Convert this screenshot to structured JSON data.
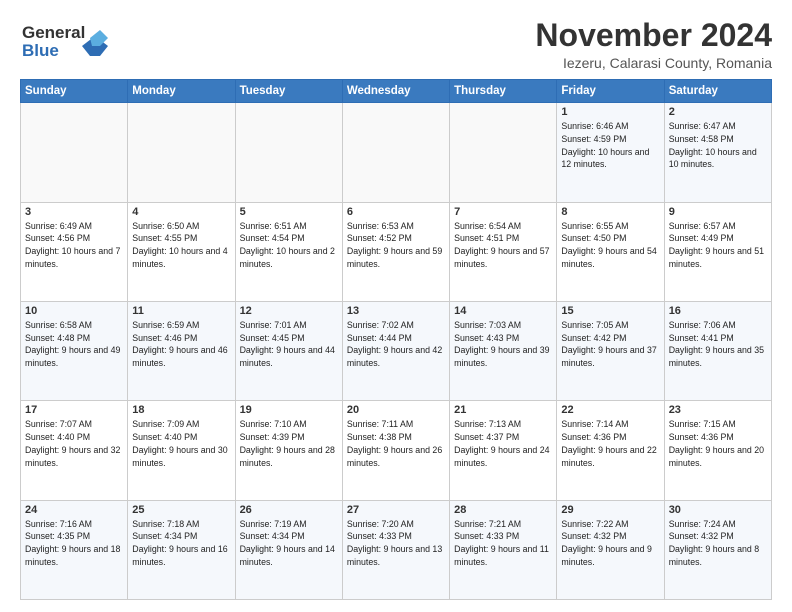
{
  "header": {
    "logo_line1": "General",
    "logo_line2": "Blue",
    "month": "November 2024",
    "location": "Iezeru, Calarasi County, Romania"
  },
  "weekdays": [
    "Sunday",
    "Monday",
    "Tuesday",
    "Wednesday",
    "Thursday",
    "Friday",
    "Saturday"
  ],
  "weeks": [
    [
      {
        "day": "",
        "sunrise": "",
        "sunset": "",
        "daylight": ""
      },
      {
        "day": "",
        "sunrise": "",
        "sunset": "",
        "daylight": ""
      },
      {
        "day": "",
        "sunrise": "",
        "sunset": "",
        "daylight": ""
      },
      {
        "day": "",
        "sunrise": "",
        "sunset": "",
        "daylight": ""
      },
      {
        "day": "",
        "sunrise": "",
        "sunset": "",
        "daylight": ""
      },
      {
        "day": "1",
        "sunrise": "Sunrise: 6:46 AM",
        "sunset": "Sunset: 4:59 PM",
        "daylight": "Daylight: 10 hours and 12 minutes."
      },
      {
        "day": "2",
        "sunrise": "Sunrise: 6:47 AM",
        "sunset": "Sunset: 4:58 PM",
        "daylight": "Daylight: 10 hours and 10 minutes."
      }
    ],
    [
      {
        "day": "3",
        "sunrise": "Sunrise: 6:49 AM",
        "sunset": "Sunset: 4:56 PM",
        "daylight": "Daylight: 10 hours and 7 minutes."
      },
      {
        "day": "4",
        "sunrise": "Sunrise: 6:50 AM",
        "sunset": "Sunset: 4:55 PM",
        "daylight": "Daylight: 10 hours and 4 minutes."
      },
      {
        "day": "5",
        "sunrise": "Sunrise: 6:51 AM",
        "sunset": "Sunset: 4:54 PM",
        "daylight": "Daylight: 10 hours and 2 minutes."
      },
      {
        "day": "6",
        "sunrise": "Sunrise: 6:53 AM",
        "sunset": "Sunset: 4:52 PM",
        "daylight": "Daylight: 9 hours and 59 minutes."
      },
      {
        "day": "7",
        "sunrise": "Sunrise: 6:54 AM",
        "sunset": "Sunset: 4:51 PM",
        "daylight": "Daylight: 9 hours and 57 minutes."
      },
      {
        "day": "8",
        "sunrise": "Sunrise: 6:55 AM",
        "sunset": "Sunset: 4:50 PM",
        "daylight": "Daylight: 9 hours and 54 minutes."
      },
      {
        "day": "9",
        "sunrise": "Sunrise: 6:57 AM",
        "sunset": "Sunset: 4:49 PM",
        "daylight": "Daylight: 9 hours and 51 minutes."
      }
    ],
    [
      {
        "day": "10",
        "sunrise": "Sunrise: 6:58 AM",
        "sunset": "Sunset: 4:48 PM",
        "daylight": "Daylight: 9 hours and 49 minutes."
      },
      {
        "day": "11",
        "sunrise": "Sunrise: 6:59 AM",
        "sunset": "Sunset: 4:46 PM",
        "daylight": "Daylight: 9 hours and 46 minutes."
      },
      {
        "day": "12",
        "sunrise": "Sunrise: 7:01 AM",
        "sunset": "Sunset: 4:45 PM",
        "daylight": "Daylight: 9 hours and 44 minutes."
      },
      {
        "day": "13",
        "sunrise": "Sunrise: 7:02 AM",
        "sunset": "Sunset: 4:44 PM",
        "daylight": "Daylight: 9 hours and 42 minutes."
      },
      {
        "day": "14",
        "sunrise": "Sunrise: 7:03 AM",
        "sunset": "Sunset: 4:43 PM",
        "daylight": "Daylight: 9 hours and 39 minutes."
      },
      {
        "day": "15",
        "sunrise": "Sunrise: 7:05 AM",
        "sunset": "Sunset: 4:42 PM",
        "daylight": "Daylight: 9 hours and 37 minutes."
      },
      {
        "day": "16",
        "sunrise": "Sunrise: 7:06 AM",
        "sunset": "Sunset: 4:41 PM",
        "daylight": "Daylight: 9 hours and 35 minutes."
      }
    ],
    [
      {
        "day": "17",
        "sunrise": "Sunrise: 7:07 AM",
        "sunset": "Sunset: 4:40 PM",
        "daylight": "Daylight: 9 hours and 32 minutes."
      },
      {
        "day": "18",
        "sunrise": "Sunrise: 7:09 AM",
        "sunset": "Sunset: 4:40 PM",
        "daylight": "Daylight: 9 hours and 30 minutes."
      },
      {
        "day": "19",
        "sunrise": "Sunrise: 7:10 AM",
        "sunset": "Sunset: 4:39 PM",
        "daylight": "Daylight: 9 hours and 28 minutes."
      },
      {
        "day": "20",
        "sunrise": "Sunrise: 7:11 AM",
        "sunset": "Sunset: 4:38 PM",
        "daylight": "Daylight: 9 hours and 26 minutes."
      },
      {
        "day": "21",
        "sunrise": "Sunrise: 7:13 AM",
        "sunset": "Sunset: 4:37 PM",
        "daylight": "Daylight: 9 hours and 24 minutes."
      },
      {
        "day": "22",
        "sunrise": "Sunrise: 7:14 AM",
        "sunset": "Sunset: 4:36 PM",
        "daylight": "Daylight: 9 hours and 22 minutes."
      },
      {
        "day": "23",
        "sunrise": "Sunrise: 7:15 AM",
        "sunset": "Sunset: 4:36 PM",
        "daylight": "Daylight: 9 hours and 20 minutes."
      }
    ],
    [
      {
        "day": "24",
        "sunrise": "Sunrise: 7:16 AM",
        "sunset": "Sunset: 4:35 PM",
        "daylight": "Daylight: 9 hours and 18 minutes."
      },
      {
        "day": "25",
        "sunrise": "Sunrise: 7:18 AM",
        "sunset": "Sunset: 4:34 PM",
        "daylight": "Daylight: 9 hours and 16 minutes."
      },
      {
        "day": "26",
        "sunrise": "Sunrise: 7:19 AM",
        "sunset": "Sunset: 4:34 PM",
        "daylight": "Daylight: 9 hours and 14 minutes."
      },
      {
        "day": "27",
        "sunrise": "Sunrise: 7:20 AM",
        "sunset": "Sunset: 4:33 PM",
        "daylight": "Daylight: 9 hours and 13 minutes."
      },
      {
        "day": "28",
        "sunrise": "Sunrise: 7:21 AM",
        "sunset": "Sunset: 4:33 PM",
        "daylight": "Daylight: 9 hours and 11 minutes."
      },
      {
        "day": "29",
        "sunrise": "Sunrise: 7:22 AM",
        "sunset": "Sunset: 4:32 PM",
        "daylight": "Daylight: 9 hours and 9 minutes."
      },
      {
        "day": "30",
        "sunrise": "Sunrise: 7:24 AM",
        "sunset": "Sunset: 4:32 PM",
        "daylight": "Daylight: 9 hours and 8 minutes."
      }
    ]
  ]
}
